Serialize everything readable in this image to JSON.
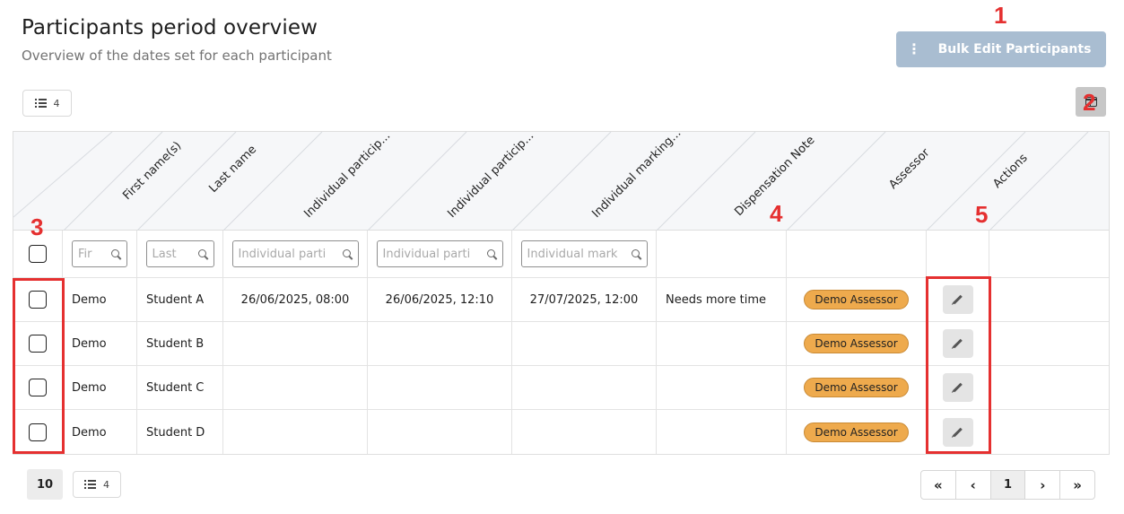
{
  "header": {
    "title": "Participants period overview",
    "subtitle": "Overview of the dates set for each participant"
  },
  "toolbar": {
    "bulk_edit_label": "Bulk Edit Participants",
    "more_icon": "vertical-dots-icon",
    "rows_count": "4",
    "columns_icon": "columns-icon"
  },
  "markers": [
    "1",
    "2",
    "3",
    "4",
    "5"
  ],
  "table": {
    "columns": [
      "First name(s)",
      "Last name",
      "Individual particip...",
      "Individual particip...",
      "Individual marking...",
      "Dispensation Note",
      "Assessor",
      "Actions"
    ],
    "filters": [
      "Fir",
      "Last",
      "Individual parti",
      "Individual parti",
      "Individual mark"
    ],
    "rows": [
      {
        "first": "Demo",
        "last": "Student A",
        "start": "26/06/2025, 08:00",
        "end": "26/06/2025, 12:10",
        "marking": "27/07/2025, 12:00",
        "note": "Needs more time",
        "assessor": "Demo Assessor"
      },
      {
        "first": "Demo",
        "last": "Student B",
        "start": "",
        "end": "",
        "marking": "",
        "note": "",
        "assessor": "Demo Assessor"
      },
      {
        "first": "Demo",
        "last": "Student C",
        "start": "",
        "end": "",
        "marking": "",
        "note": "",
        "assessor": "Demo Assessor"
      },
      {
        "first": "Demo",
        "last": "Student D",
        "start": "",
        "end": "",
        "marking": "",
        "note": "",
        "assessor": "Demo Assessor"
      }
    ]
  },
  "footer": {
    "page_size": "10",
    "rows_count": "4",
    "pagination": {
      "first": "«",
      "prev": "‹",
      "current": "1",
      "next": "›",
      "last": "»"
    }
  },
  "colors": {
    "accent": "#a9bdd1",
    "badge": "#eeaa4d",
    "marker": "#e53030"
  }
}
